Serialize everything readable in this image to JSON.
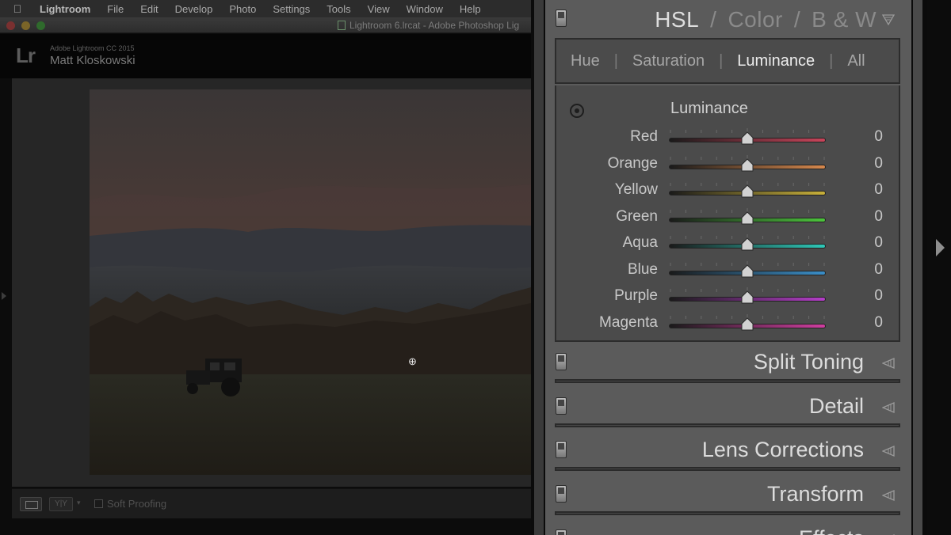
{
  "menubar": {
    "apple_icon": "apple-icon",
    "items": [
      "Lightroom",
      "File",
      "Edit",
      "Develop",
      "Photo",
      "Settings",
      "Tools",
      "View",
      "Window",
      "Help"
    ]
  },
  "window": {
    "title": "Lightroom 6.lrcat - Adobe Photoshop Lig"
  },
  "identity": {
    "logo": "Lr",
    "version": "Adobe Lightroom CC 2015",
    "user": "Matt Kloskowski"
  },
  "toolbar": {
    "soft_proofing_label": "Soft Proofing",
    "soft_proofing_checked": false,
    "yy_label": "Y|Y"
  },
  "hsl_panel": {
    "title_parts": [
      "HSL",
      "/",
      "Color",
      "/",
      "B & W"
    ],
    "active_title": "HSL",
    "subtabs": [
      "Hue",
      "Saturation",
      "Luminance",
      "All"
    ],
    "active_subtab": "Luminance",
    "section_label": "Luminance",
    "sliders": [
      {
        "name": "Red",
        "value": "0",
        "level": 0,
        "color": "#c8445a"
      },
      {
        "name": "Orange",
        "value": "0",
        "level": 0,
        "color": "#d6884d"
      },
      {
        "name": "Yellow",
        "value": "0",
        "level": 0,
        "color": "#c8b03a"
      },
      {
        "name": "Green",
        "value": "0",
        "level": 0,
        "color": "#4cc43c"
      },
      {
        "name": "Aqua",
        "value": "0",
        "level": 0,
        "color": "#2ec8b8"
      },
      {
        "name": "Blue",
        "value": "0",
        "level": 0,
        "color": "#3a8ec8"
      },
      {
        "name": "Purple",
        "value": "0",
        "level": 0,
        "color": "#b43ec8"
      },
      {
        "name": "Magenta",
        "value": "0",
        "level": 0,
        "color": "#d03ea0"
      }
    ]
  },
  "collapsed_panels": [
    "Split Toning",
    "Detail",
    "Lens Corrections",
    "Transform",
    "Effects"
  ]
}
